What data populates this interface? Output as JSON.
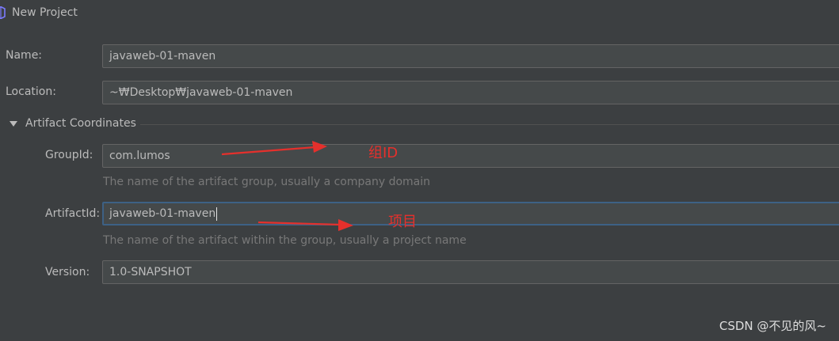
{
  "window": {
    "title": "New Project",
    "icon": "intellij-logo-icon"
  },
  "form": {
    "name": {
      "label": "Name:",
      "value": "javaweb-01-maven"
    },
    "location": {
      "label": "Location:",
      "value": "~₩Desktop₩javaweb-01-maven"
    }
  },
  "artifact_section": {
    "title": "Artifact Coordinates",
    "toggle_icon": "triangle-down-icon",
    "expanded": true,
    "group_id": {
      "label": "GroupId:",
      "value": "com.lumos",
      "hint": "The name of the artifact group, usually a company domain"
    },
    "artifact_id": {
      "label": "ArtifactId:",
      "value": "javaweb-01-maven",
      "hint": "The name of the artifact within the group, usually a project name",
      "focused": true
    },
    "version": {
      "label": "Version:",
      "value": "1.0-SNAPSHOT"
    }
  },
  "annotations": {
    "group_note": "组ID",
    "artifact_note": "项目",
    "color": "#e5302c"
  },
  "watermark": "CSDN @不见的风~",
  "colors": {
    "background": "#3c3f41",
    "field_background": "#45494a",
    "field_border": "#646464",
    "focus_border": "#3d6185",
    "text": "#bbbbbb",
    "hint_text": "#787878"
  }
}
